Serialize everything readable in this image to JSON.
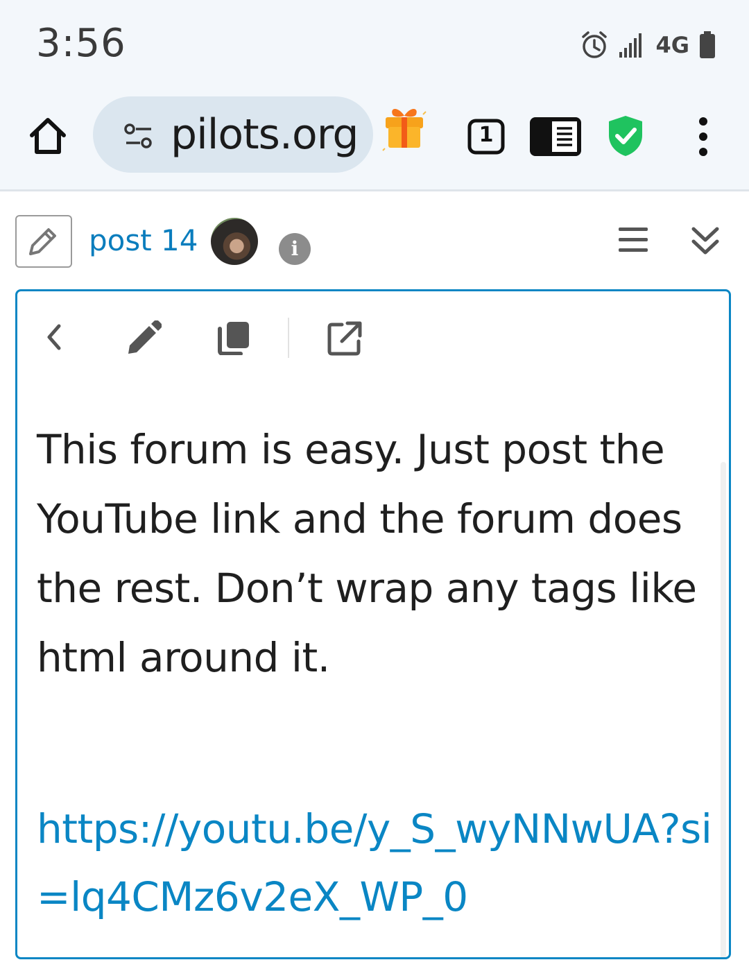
{
  "status_bar": {
    "time": "3:56",
    "network": "4G",
    "icons": [
      "alarm-icon",
      "signal-icon",
      "battery-icon"
    ]
  },
  "browser": {
    "url": "pilots.org",
    "tab_count": "1",
    "icons": [
      "home-icon",
      "site-settings-icon",
      "gift-icon",
      "tabs-icon",
      "reader-mode-icon",
      "shield-check-icon",
      "more-vert-icon"
    ],
    "colors": {
      "shield": "#1fc35f",
      "gift": "#f7a21b"
    }
  },
  "post_header": {
    "post_label": "post 14",
    "info_glyph": "i",
    "icons": [
      "pencil-icon",
      "avatar",
      "info-icon",
      "hamburger-icon",
      "double-chevron-down-icon"
    ]
  },
  "post_card": {
    "toolbar_icons": [
      "back-chevron-icon",
      "edit-pencil-icon",
      "copy-icon",
      "open-external-icon"
    ],
    "body_text": "This forum is easy. Just post the YouTube link and the forum does the rest. Don’t wrap any tags like html around it.",
    "link_text": "https://youtu.be/y_S_wyNNwUA?si=lq4CMz6v2eX_WP_0",
    "colors": {
      "border": "#0a86c4",
      "link": "#0a86c4"
    }
  }
}
